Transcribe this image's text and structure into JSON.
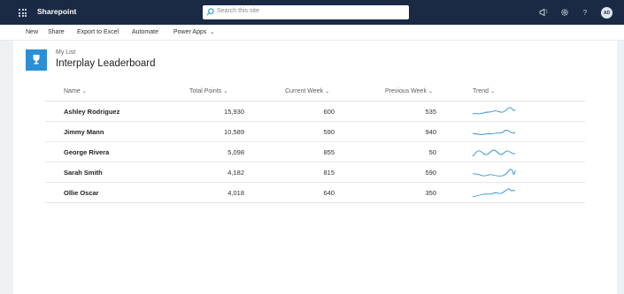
{
  "topbar": {
    "app_name": "Sharepoint",
    "search_placeholder": "Search this site",
    "icons": [
      "waffle-icon",
      "megaphone-icon",
      "settings-icon",
      "help-icon"
    ],
    "avatar_initials": "AD"
  },
  "commandbar": {
    "items": [
      "New",
      "Share",
      "Export to Excel",
      "Automate",
      "Power Apps"
    ]
  },
  "list": {
    "subtitle": "My List",
    "title": "Interplay Leaderboard"
  },
  "table": {
    "columns": [
      "Name",
      "Total Points",
      "Current Week",
      "Previous Week",
      "Trend"
    ],
    "rows": [
      {
        "name": "Ashley Rodriguez",
        "total": "15,930",
        "current": "600",
        "previous": "535"
      },
      {
        "name": "Jimmy Mann",
        "total": "10,589",
        "current": "590",
        "previous": "940"
      },
      {
        "name": "George Rivera",
        "total": "5,098",
        "current": "855",
        "previous": "50"
      },
      {
        "name": "Sarah Smith",
        "total": "4,182",
        "current": "815",
        "previous": "590"
      },
      {
        "name": "Ollie Oscar",
        "total": "4,018",
        "current": "640",
        "previous": "350"
      }
    ]
  },
  "colors": {
    "topbar": "#1b2a44",
    "accent": "#2b8fd6",
    "sparkline": "#2b8fd6"
  }
}
